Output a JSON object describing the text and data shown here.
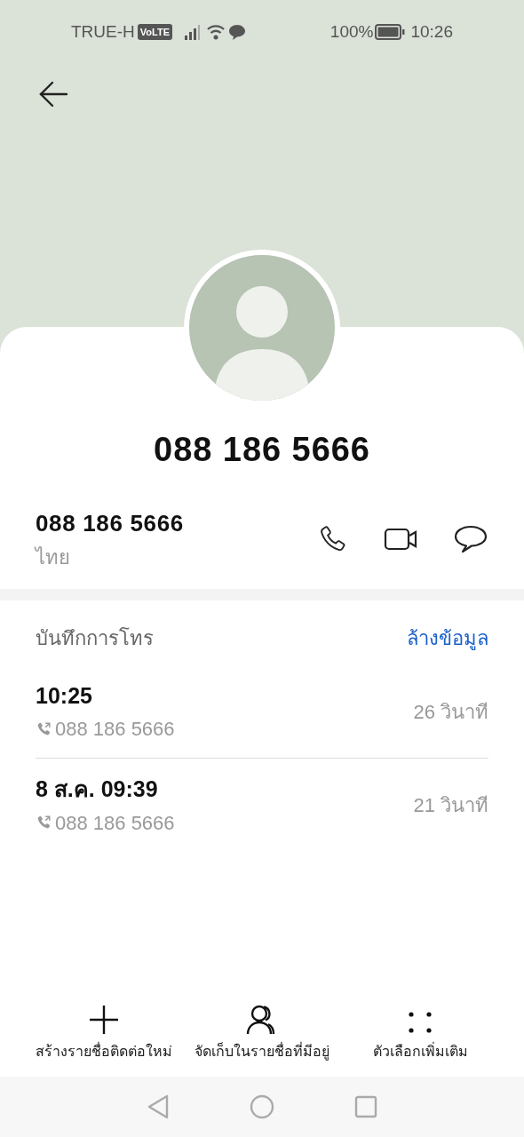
{
  "status_bar": {
    "carrier": "TRUE-H",
    "volte": "VoLTE",
    "battery": "100%",
    "time": "10:26"
  },
  "contact": {
    "title": "088 186 5666",
    "number": "088 186 5666",
    "region": "ไทย"
  },
  "call_log": {
    "heading": "บันทึกการโทร",
    "clear": "ล้างข้อมูล",
    "entries": [
      {
        "time": "10:25",
        "number": "088 186 5666",
        "duration": "26 วินาที"
      },
      {
        "time": "8 ส.ค. 09:39",
        "number": "088 186 5666",
        "duration": "21 วินาที"
      }
    ]
  },
  "actions": [
    {
      "kind": "add",
      "label": "สร้างรายชื่อติดต่อใหม่"
    },
    {
      "kind": "contacts",
      "label": "จัดเก็บในรายชื่อที่มีอยู่"
    },
    {
      "kind": "more",
      "label": "ตัวเลือกเพิ่มเติม"
    }
  ]
}
